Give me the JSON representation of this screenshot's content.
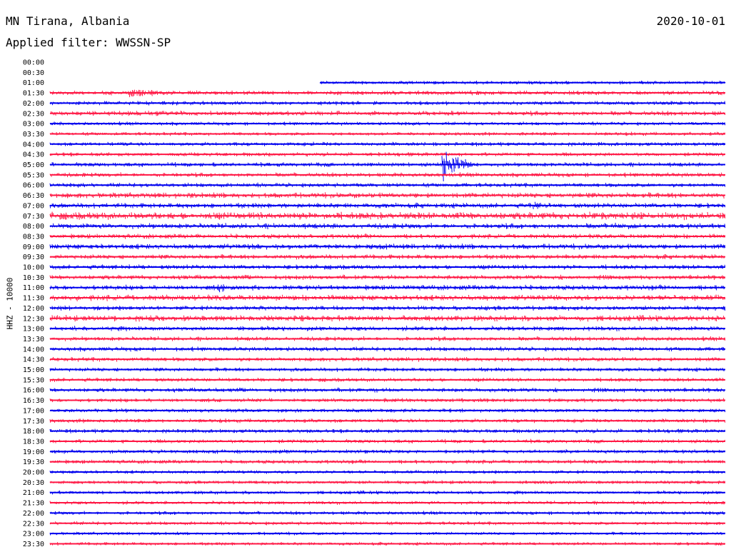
{
  "header": {
    "station": "MN Tirana, Albania",
    "date": "2020-10-01",
    "filter": "Applied filter: WWSSN-SP",
    "channel_label": "HHZ - 10000"
  },
  "colors": {
    "even_row": "#0000ee",
    "odd_row": "#ff1744"
  },
  "chart_data": {
    "type": "line",
    "title": "MN Tirana, Albania",
    "subtitle": "Applied filter: WWSSN-SP",
    "date": "2020-10-01",
    "ylabel": "HHZ - 10000",
    "row_labels": [
      "00:00",
      "00:30",
      "01:00",
      "01:30",
      "02:00",
      "02:30",
      "03:00",
      "03:30",
      "04:00",
      "04:30",
      "05:00",
      "05:30",
      "06:00",
      "06:30",
      "07:00",
      "07:30",
      "08:00",
      "08:30",
      "09:00",
      "09:30",
      "10:00",
      "10:30",
      "11:00",
      "11:30",
      "12:00",
      "12:30",
      "13:00",
      "13:30",
      "14:00",
      "14:30",
      "15:00",
      "15:30",
      "16:00",
      "16:30",
      "17:00",
      "17:30",
      "18:00",
      "18:30",
      "19:00",
      "19:30",
      "20:00",
      "20:30",
      "21:00",
      "21:30",
      "22:00",
      "22:30",
      "23:00",
      "23:30"
    ],
    "minutes_per_row": 30,
    "data_start_row": "01:00",
    "data_start_minute": 12,
    "row_colors": [
      "blue",
      "red"
    ],
    "relative_amplitude_baseline": [
      0,
      0,
      1.0,
      1.2,
      1.1,
      1.3,
      1.0,
      1.0,
      1.1,
      1.1,
      1.2,
      1.2,
      1.2,
      1.5,
      1.4,
      2.0,
      1.5,
      1.3,
      1.5,
      1.3,
      1.3,
      1.3,
      1.4,
      1.6,
      1.3,
      1.6,
      1.3,
      1.2,
      1.2,
      1.2,
      1.1,
      1.1,
      1.2,
      1.1,
      1.1,
      1.1,
      1.1,
      1.1,
      1.1,
      1.1,
      1.0,
      1.0,
      1.0,
      1.0,
      1.0,
      1.0,
      0.9,
      0.9
    ],
    "events": [
      {
        "row": "01:30",
        "minute": 3.5,
        "amplitude": 7,
        "duration_min": 5
      },
      {
        "row": "02:30",
        "minute": 4,
        "amplitude": 4,
        "duration_min": 15
      },
      {
        "row": "03:30",
        "minute": 13.5,
        "amplitude": 3,
        "duration_min": 0.5
      },
      {
        "row": "05:00",
        "minute": 17.5,
        "amplitude": 28,
        "duration_min": 1.5
      },
      {
        "row": "07:00",
        "minute": 21.5,
        "amplitude": 6,
        "duration_min": 2
      },
      {
        "row": "07:30",
        "minute": 24,
        "amplitude": 5,
        "duration_min": 4
      },
      {
        "row": "08:00",
        "minute": 25,
        "amplitude": 5,
        "duration_min": 3
      },
      {
        "row": "09:00",
        "minute": 9,
        "amplitude": 5,
        "duration_min": 4
      },
      {
        "row": "09:00",
        "minute": 14.5,
        "amplitude": 5,
        "duration_min": 1
      },
      {
        "row": "11:00",
        "minute": 7.5,
        "amplitude": 8,
        "duration_min": 2
      },
      {
        "row": "11:00",
        "minute": 9,
        "amplitude": 5,
        "duration_min": 1
      },
      {
        "row": "12:30",
        "minute": 2.5,
        "amplitude": 5,
        "duration_min": 1
      },
      {
        "row": "12:30",
        "minute": 4.5,
        "amplitude": 5,
        "duration_min": 1.5
      }
    ]
  }
}
